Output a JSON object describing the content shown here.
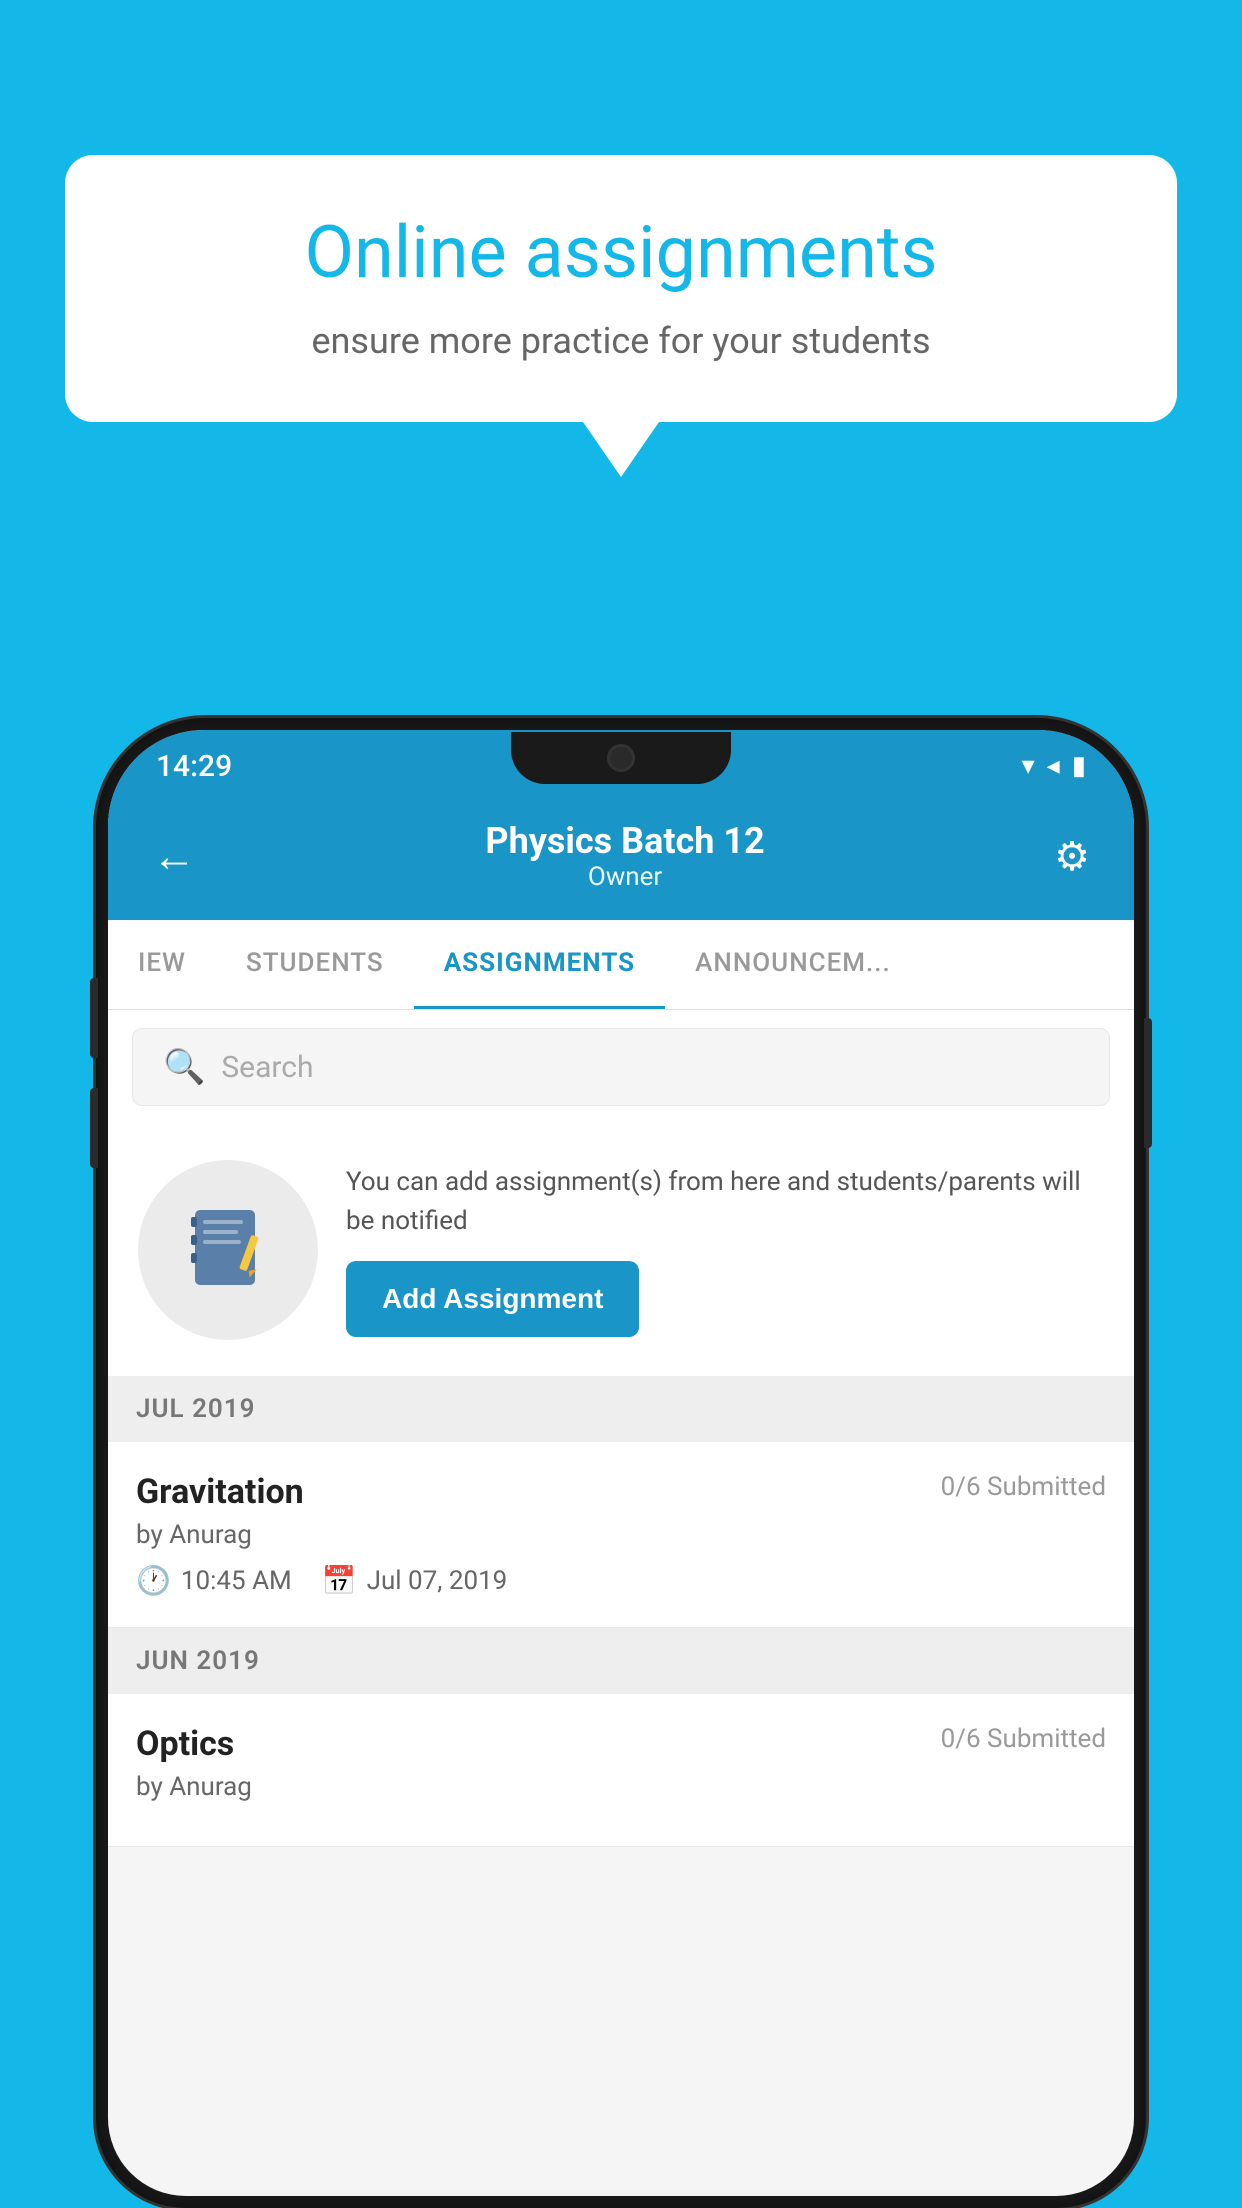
{
  "background_color": "#14B8E8",
  "speech_bubble": {
    "title": "Online assignments",
    "subtitle": "ensure more practice for your students"
  },
  "status_bar": {
    "time": "14:29",
    "wifi": "▼",
    "signal": "▲",
    "battery": "▮"
  },
  "header": {
    "title": "Physics Batch 12",
    "subtitle": "Owner",
    "back_label": "←",
    "settings_label": "⚙"
  },
  "tabs": [
    {
      "label": "IEW",
      "active": false
    },
    {
      "label": "STUDENTS",
      "active": false
    },
    {
      "label": "ASSIGNMENTS",
      "active": true
    },
    {
      "label": "ANNOUNCEM...",
      "active": false
    }
  ],
  "search": {
    "placeholder": "Search"
  },
  "promo": {
    "icon": "📓",
    "description": "You can add assignment(s) from here and students/parents will be notified",
    "button_label": "Add Assignment"
  },
  "sections": [
    {
      "month": "JUL 2019",
      "assignments": [
        {
          "title": "Gravitation",
          "submitted": "0/6 Submitted",
          "author": "by Anurag",
          "time": "10:45 AM",
          "date": "Jul 07, 2019"
        }
      ]
    },
    {
      "month": "JUN 2019",
      "assignments": [
        {
          "title": "Optics",
          "submitted": "0/6 Submitted",
          "author": "by Anurag",
          "time": "",
          "date": ""
        }
      ]
    }
  ]
}
